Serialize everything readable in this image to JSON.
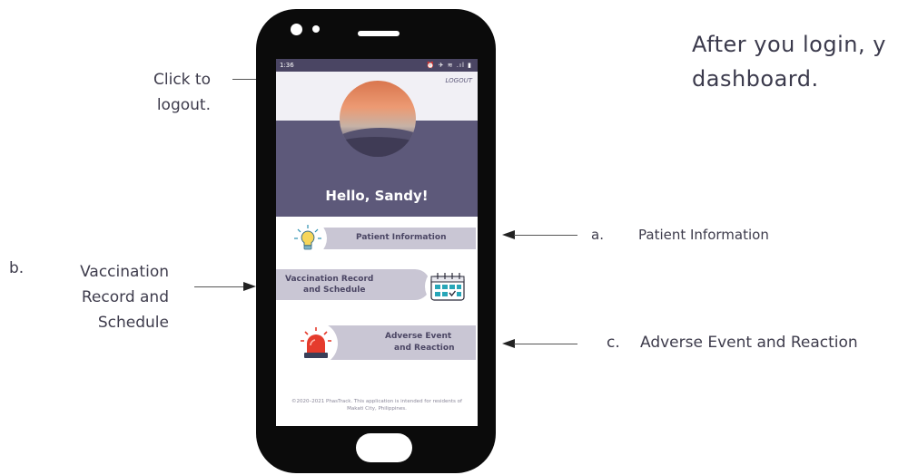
{
  "heading": {
    "line1": "After you login, y",
    "line2": "dashboard."
  },
  "callouts": {
    "logout": {
      "line1": "Click to",
      "line2": "logout."
    },
    "b": {
      "marker": "b.",
      "line1": "Vaccination",
      "line2": "Record and",
      "line3": "Schedule"
    },
    "a": {
      "marker": "a.",
      "text": "Patient Information"
    },
    "c": {
      "marker": "c.",
      "text": "Adverse Event and Reaction"
    }
  },
  "phone": {
    "status": {
      "time": "1:36",
      "icons": "⏰ ✈ ≋ .ıl ▮"
    },
    "logout_label": "LOGOUT",
    "greeting": "Hello, Sandy!",
    "menu": {
      "patient_info": "Patient Information",
      "vaccination_line1": "Vaccination Record",
      "vaccination_line2": "and Schedule",
      "adverse_line1": "Adverse Event",
      "adverse_line2": "and Reaction"
    },
    "footer_line1": "©2020–2021 PhasTrack. This application is intended for residents of",
    "footer_line2": "Makati City, Philippines."
  },
  "colors": {
    "band": "#5d597a",
    "pill": "#c9c6d4",
    "siren": "#e53b2c",
    "calendar": "#27a6b8"
  }
}
